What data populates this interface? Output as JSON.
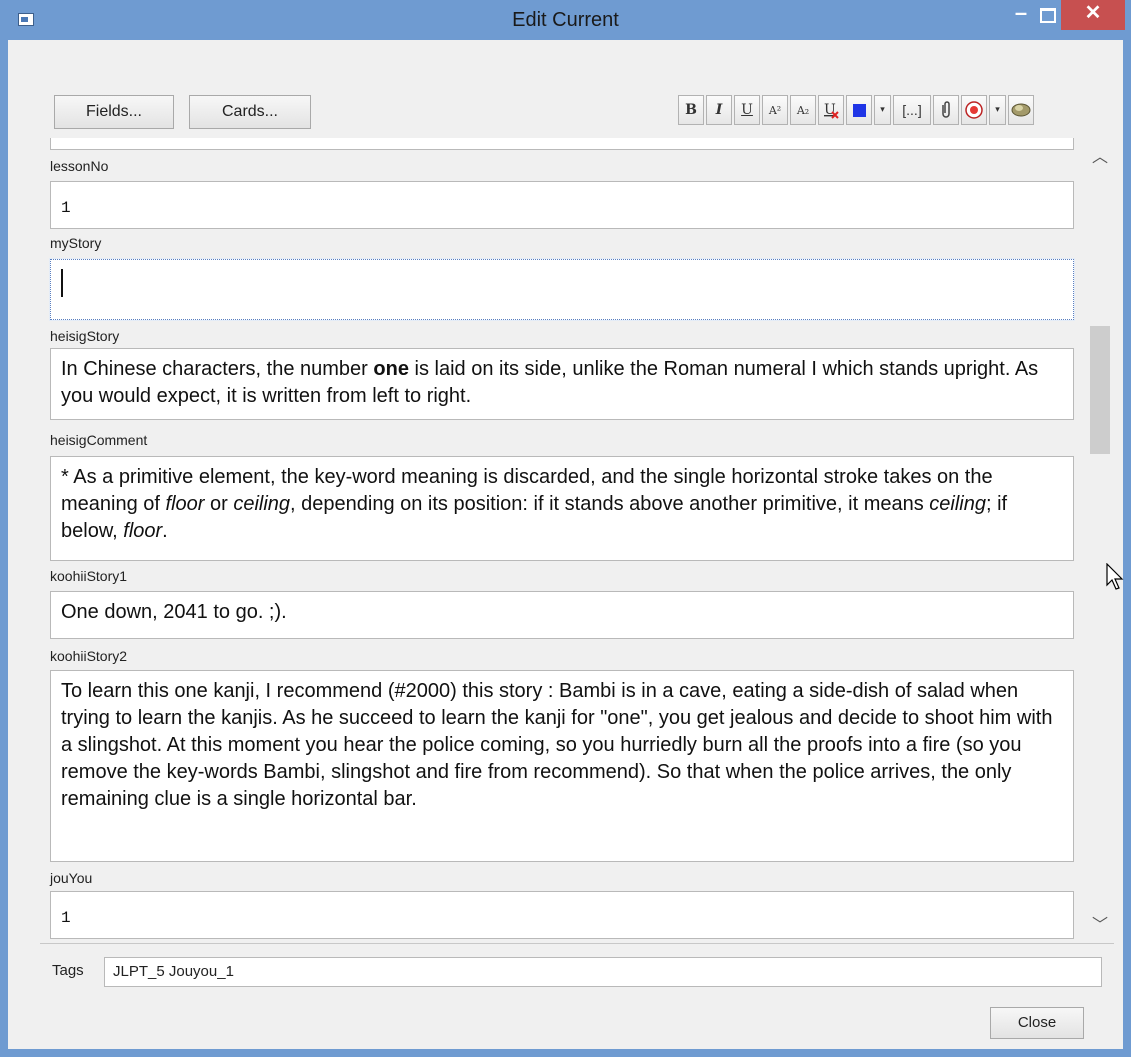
{
  "window": {
    "title": "Edit Current"
  },
  "buttons": {
    "fields": "Fields...",
    "cards": "Cards...",
    "close": "Close"
  },
  "toolbar": {
    "bold": "B",
    "italic": "I",
    "underline": "U",
    "superscript": "A²",
    "subscript": "A₂",
    "dropdown": "▾",
    "cloze": "[...]",
    "dropdown2": "▾",
    "text_color": "#1f35e6",
    "record_color": "#e53935"
  },
  "fields": [
    {
      "label": "lessonNo",
      "value": "1"
    },
    {
      "label": "myStory",
      "value": ""
    },
    {
      "label": "heisigStory",
      "value_html": "In Chinese characters, the number <b>one</b> is laid on its side, unlike the Roman numeral I which stands upright. As you would expect, it is written from left to right."
    },
    {
      "label": "heisigComment",
      "value_html": "* As a primitive element, the key-word meaning is discarded, and the single horizontal stroke takes on the meaning of <i>floor</i> or <i>ceiling</i>, depending on its position: if it stands above another primitive, it means <i>ceiling</i>; if below, <i>floor</i>."
    },
    {
      "label": "koohiiStory1",
      "value": "One down, 2041 to go. ;)."
    },
    {
      "label": "koohiiStory2",
      "value": "To learn this one kanji, I recommend (#2000) this story : Bambi is in a cave, eating a side-dish of salad when trying to learn the kanjis. As he succeed to learn the kanji for \"one\", you get jealous and decide to shoot him with a slingshot. At this moment you hear the police coming, so you hurriedly burn all the proofs into a fire (so you remove the key-words Bambi, slingshot and fire from recommend). So that when the police arrives, the only remaining clue is a single horizontal bar."
    },
    {
      "label": "jouYou",
      "value": "1"
    }
  ],
  "tags": {
    "label": "Tags",
    "value": "JLPT_5 Jouyou_1"
  }
}
